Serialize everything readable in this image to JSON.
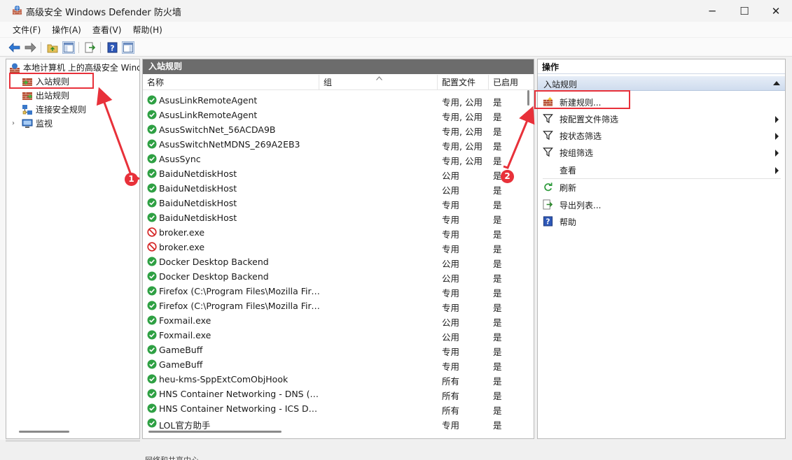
{
  "window": {
    "title": "高级安全 Windows Defender 防火墙",
    "icons": {
      "app": "firewall-app-icon",
      "minimize": "─",
      "maximize": "☐",
      "close": "✕"
    }
  },
  "menu": [
    "文件(F)",
    "操作(A)",
    "查看(V)",
    "帮助(H)"
  ],
  "tree": {
    "root": "本地计算机 上的高级安全 Windows Defender 防火墙",
    "items": [
      {
        "label": "入站规则",
        "icon": "inbound-rules-icon"
      },
      {
        "label": "出站规则",
        "icon": "outbound-rules-icon"
      },
      {
        "label": "连接安全规则",
        "icon": "connection-security-icon"
      },
      {
        "label": "监视",
        "icon": "monitor-icon"
      }
    ]
  },
  "main": {
    "header": "入站规则",
    "columns": {
      "name": "名称",
      "group": "组",
      "profile": "配置文件",
      "enabled": "已启用"
    },
    "rows": [
      {
        "name": "AsusLinkRemoteAgent",
        "profile": "专用, 公用",
        "enabled": "是",
        "status": "allow"
      },
      {
        "name": "AsusLinkRemoteAgent",
        "profile": "专用, 公用",
        "enabled": "是",
        "status": "allow"
      },
      {
        "name": "AsusSwitchNet_56ACDA9B",
        "profile": "专用, 公用",
        "enabled": "是",
        "status": "allow"
      },
      {
        "name": "AsusSwitchNetMDNS_269A2EB3",
        "profile": "专用, 公用",
        "enabled": "是",
        "status": "allow"
      },
      {
        "name": "AsusSync",
        "profile": "专用, 公用",
        "enabled": "是",
        "status": "allow"
      },
      {
        "name": "BaiduNetdiskHost",
        "profile": "公用",
        "enabled": "是",
        "status": "allow"
      },
      {
        "name": "BaiduNetdiskHost",
        "profile": "公用",
        "enabled": "是",
        "status": "allow"
      },
      {
        "name": "BaiduNetdiskHost",
        "profile": "专用",
        "enabled": "是",
        "status": "allow"
      },
      {
        "name": "BaiduNetdiskHost",
        "profile": "专用",
        "enabled": "是",
        "status": "allow"
      },
      {
        "name": "broker.exe",
        "profile": "专用",
        "enabled": "是",
        "status": "block"
      },
      {
        "name": "broker.exe",
        "profile": "专用",
        "enabled": "是",
        "status": "block"
      },
      {
        "name": "Docker Desktop Backend",
        "profile": "公用",
        "enabled": "是",
        "status": "allow"
      },
      {
        "name": "Docker Desktop Backend",
        "profile": "公用",
        "enabled": "是",
        "status": "allow"
      },
      {
        "name": "Firefox (C:\\Program Files\\Mozilla Fire...",
        "profile": "专用",
        "enabled": "是",
        "status": "allow"
      },
      {
        "name": "Firefox (C:\\Program Files\\Mozilla Fire...",
        "profile": "专用",
        "enabled": "是",
        "status": "allow"
      },
      {
        "name": "Foxmail.exe",
        "profile": "公用",
        "enabled": "是",
        "status": "allow"
      },
      {
        "name": "Foxmail.exe",
        "profile": "公用",
        "enabled": "是",
        "status": "allow"
      },
      {
        "name": "GameBuff",
        "profile": "专用",
        "enabled": "是",
        "status": "allow"
      },
      {
        "name": "GameBuff",
        "profile": "专用",
        "enabled": "是",
        "status": "allow"
      },
      {
        "name": "heu-kms-SppExtComObjHook",
        "profile": "所有",
        "enabled": "是",
        "status": "allow"
      },
      {
        "name": "HNS Container Networking - DNS (U...",
        "profile": "所有",
        "enabled": "是",
        "status": "allow"
      },
      {
        "name": "HNS Container Networking - ICS DN...",
        "profile": "所有",
        "enabled": "是",
        "status": "allow"
      },
      {
        "name": "LOL官方助手",
        "profile": "专用",
        "enabled": "是",
        "status": "allow"
      }
    ]
  },
  "actions": {
    "header": "操作",
    "section": "入站规则",
    "items": [
      {
        "label": "新建规则...",
        "icon": "new-rule-icon",
        "submenu": false
      },
      {
        "label": "按配置文件筛选",
        "icon": "filter-icon",
        "submenu": true
      },
      {
        "label": "按状态筛选",
        "icon": "filter-icon",
        "submenu": true
      },
      {
        "label": "按组筛选",
        "icon": "filter-icon",
        "submenu": true
      },
      {
        "label": "查看",
        "icon": "",
        "submenu": true
      },
      {
        "label": "刷新",
        "icon": "refresh-icon",
        "submenu": false
      },
      {
        "label": "导出列表...",
        "icon": "export-icon",
        "submenu": false
      },
      {
        "label": "帮助",
        "icon": "help-icon",
        "submenu": false
      }
    ]
  },
  "annotations": {
    "badge1": "1",
    "badge2": "2",
    "color": "#e8313a"
  },
  "status": {
    "fragment": "网络和共享中心"
  },
  "colors": {
    "panel_header": "#6c6c6c",
    "allow": "#2ea043",
    "block": "#d42020",
    "selection_border": "#e8313a"
  }
}
